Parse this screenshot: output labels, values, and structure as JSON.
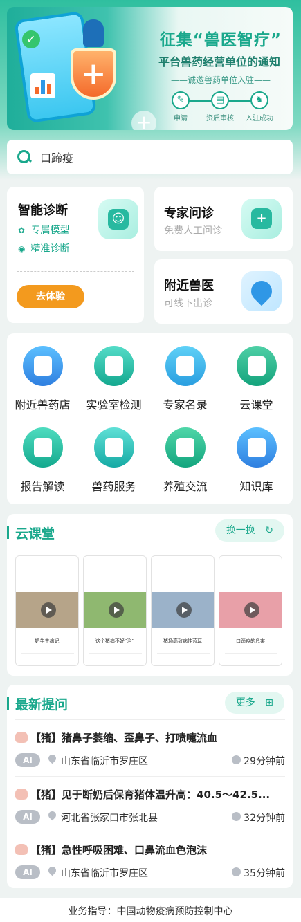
{
  "banner": {
    "title": "征集“兽医智疗”",
    "subtitle": "平台兽药经营单位的通知",
    "invite": "——诚邀兽药单位入驻——",
    "steps": [
      {
        "label": "申请",
        "icon": "form-icon"
      },
      {
        "label": "资质审核",
        "icon": "document-icon"
      },
      {
        "label": "入驻成功",
        "icon": "cow-icon"
      }
    ]
  },
  "search": {
    "value": "口蹄疫"
  },
  "services": {
    "diagnosis": {
      "title": "智能诊断",
      "tag1": "专属模型",
      "tag2": "精准诊断",
      "button": "去体验",
      "icon": "robot-icon"
    },
    "expert": {
      "title": "专家问诊",
      "subtitle": "免费人工问诊",
      "icon": "doctor-icon"
    },
    "nearby_vet": {
      "title": "附近兽医",
      "subtitle": "可线下出诊",
      "icon": "location-pin-icon"
    }
  },
  "grid": [
    {
      "label": "附近兽药店",
      "color": "#2f97e6",
      "icon": "pharmacy-icon"
    },
    {
      "label": "实验室检测",
      "color": "#1fb3a0",
      "icon": "flask-icon"
    },
    {
      "label": "专家名录",
      "color": "#2aa7de",
      "icon": "clipboard-icon"
    },
    {
      "label": "云课堂",
      "color": "#1fae8d",
      "icon": "cloud-icon"
    },
    {
      "label": "报告解读",
      "color": "#20b59d",
      "icon": "report-icon"
    },
    {
      "label": "兽药服务",
      "color": "#28b8b0",
      "icon": "heart-hand-icon"
    },
    {
      "label": "养殖交流",
      "color": "#1fae8d",
      "icon": "chat-doc-icon"
    },
    {
      "label": "知识库",
      "color": "#2f97e6",
      "icon": "book-icon"
    }
  ],
  "cloud_class": {
    "title": "云课堂",
    "refresh_label": "换一换",
    "videos": [
      {
        "caption": "奶牛生病记",
        "thumb_color": "#b6a489"
      },
      {
        "caption": "这个猪病不好“治”",
        "thumb_color": "#8fb870"
      },
      {
        "caption": "猪场高致病性蓝耳",
        "thumb_color": "#9bb2c9"
      },
      {
        "caption": "口蹄疫的危害",
        "thumb_color": "#e8a0a8"
      }
    ]
  },
  "questions": {
    "title": "最新提问",
    "more_label": "更多",
    "items": [
      {
        "title": "【猪】猪鼻子萎缩、歪鼻子、打喷嚏流血",
        "badge": "AI",
        "location": "山东省临沂市罗庄区",
        "time": "29分钟前"
      },
      {
        "title": "【猪】见于断奶后保育猪体温升高：40.5～42.5...",
        "badge": "AI",
        "location": "河北省张家口市张北县",
        "time": "32分钟前"
      },
      {
        "title": "【猪】急性呼吸困难、口鼻流血色泡沫",
        "badge": "AI",
        "location": "山东省临沂市罗庄区",
        "time": "35分钟前"
      }
    ]
  },
  "footer": {
    "text": "业务指导：中国动物疫病预防控制中心"
  }
}
